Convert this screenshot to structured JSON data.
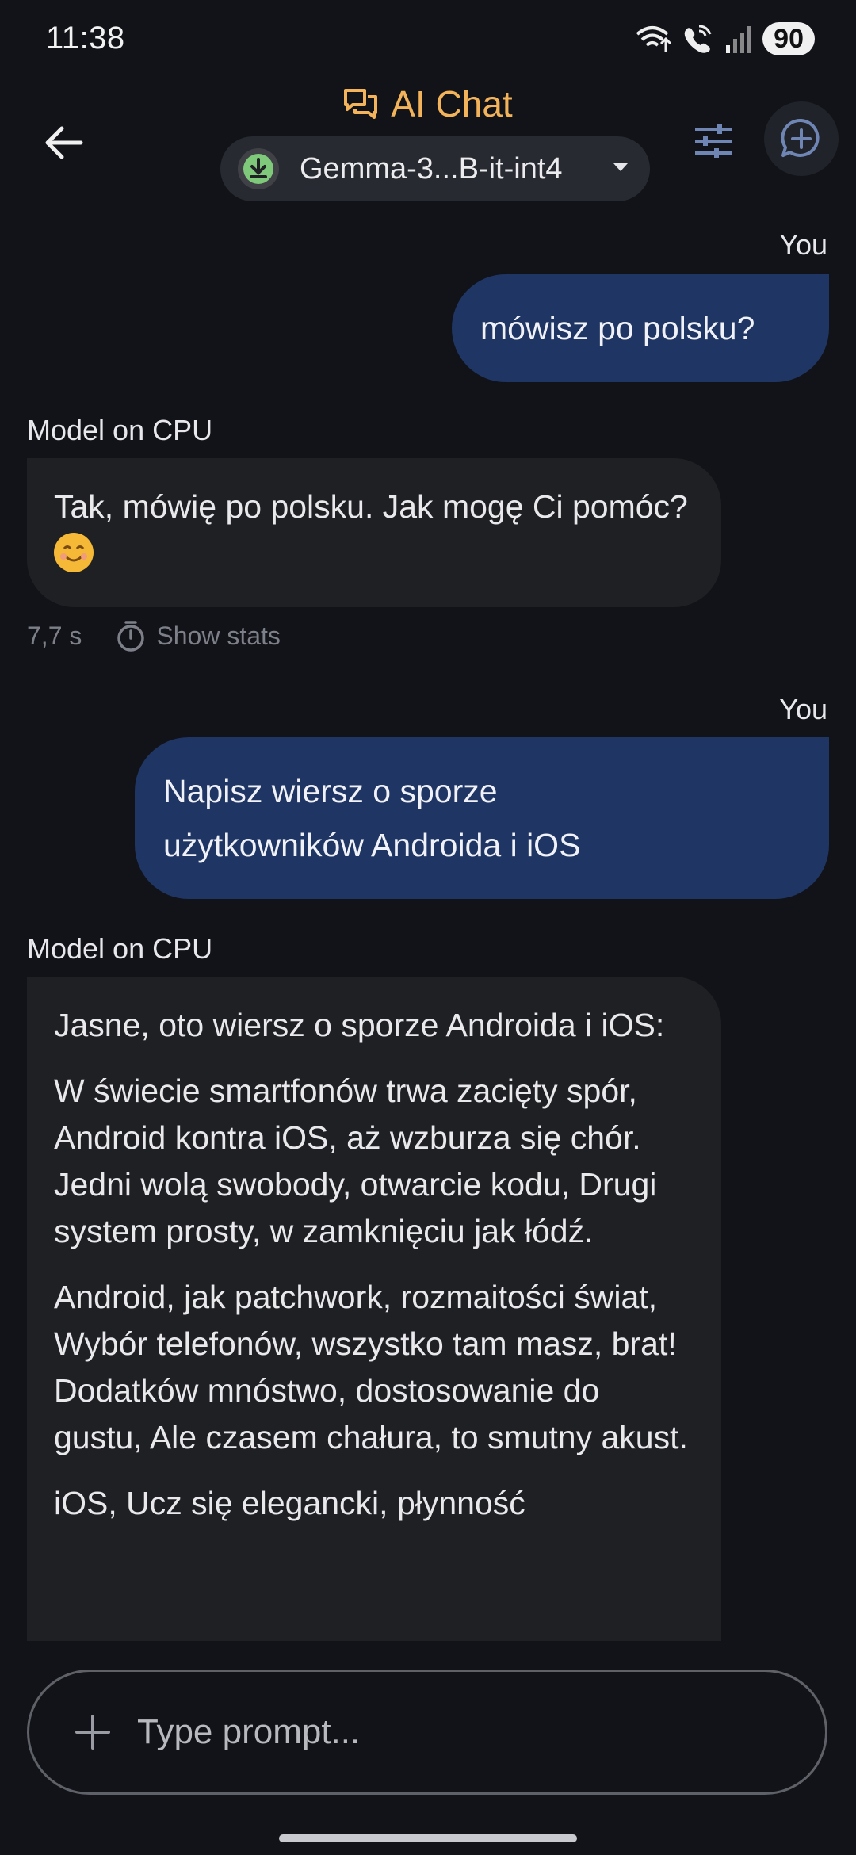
{
  "status_bar": {
    "time": "11:38",
    "battery": "90",
    "icons": [
      "wifi-calling-icon",
      "wifi-call-icon",
      "signal-icon",
      "battery-icon"
    ]
  },
  "header": {
    "title": "AI Chat",
    "title_icon": "chat-bubbles-icon",
    "model_name": "Gemma-3...B-it-int4",
    "back_icon": "arrow-back-icon",
    "tune_icon": "tune-icon",
    "new_chat_icon": "add-comment-icon"
  },
  "messages": [
    {
      "role": "user",
      "sender": "You",
      "text": "mówisz po polsku?"
    },
    {
      "role": "model",
      "sender": "Model on CPU",
      "text": "Tak, mówię po polsku. Jak mogę Ci pomóc?",
      "emoji": "smiling-face",
      "time": "7,7 s",
      "stats_label": "Show stats"
    },
    {
      "role": "user",
      "sender": "You",
      "text_lines": [
        "Napisz wiersz o sporze",
        "użytkowników Androida i iOS"
      ]
    },
    {
      "role": "model",
      "sender": "Model on CPU",
      "paragraphs": [
        "Jasne, oto wiersz o sporze Androida i iOS:",
        "W świecie smartfonów trwa zacięty spór, Android kontra iOS, aż wzburza się chór. Jedni wolą swobody, otwarcie kodu, Drugi system prosty, w zamknięciu jak łódź.",
        "Android, jak patchwork, rozmaitości świat, Wybór telefonów, wszystko tam masz, brat! Dodatków mnóstwo, dostosowanie do gustu, Ale czasem chałura, to smutny akust.",
        "iOS, Ucz się elegancki, płynność"
      ]
    }
  ],
  "input": {
    "placeholder": "Type prompt...",
    "value": ""
  },
  "colors": {
    "background": "#111318",
    "accent": "#f3b35a",
    "user_bubble": "#1f3563",
    "model_bubble": "#1f2024"
  }
}
